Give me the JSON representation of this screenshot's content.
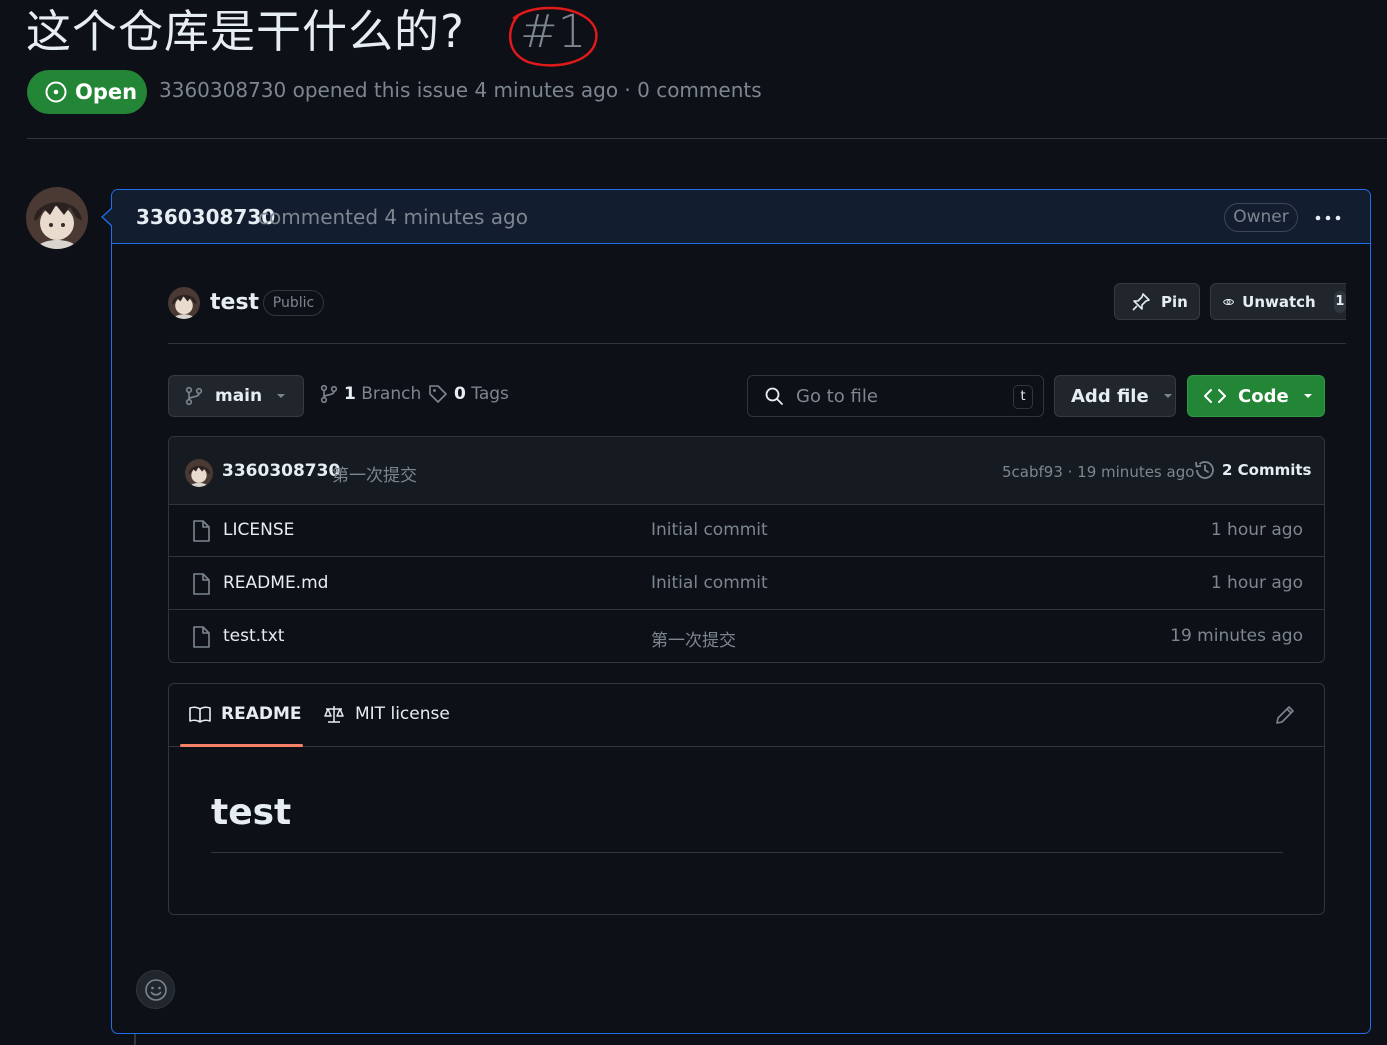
{
  "issue": {
    "title": "这个仓库是干什么的?",
    "number": "#1",
    "status": "Open",
    "author": "3360308730",
    "opened_text": "opened this issue 4 minutes ago · 0 comments"
  },
  "comment": {
    "author": "3360308730",
    "meta": "commented 4 minutes ago",
    "role_badge": "Owner"
  },
  "repo": {
    "name": "test",
    "visibility": "Public",
    "pin_label": "Pin",
    "unwatch_label": "Unwatch",
    "watch_count": "1"
  },
  "toolbar": {
    "branch": "main",
    "branch_count": "1",
    "branch_label": "Branch",
    "tag_count": "0",
    "tag_label": "Tags",
    "search_placeholder": "Go to file",
    "search_kbd": "t",
    "add_file_label": "Add file",
    "code_label": "Code"
  },
  "latest_commit": {
    "author": "3360308730",
    "message": "第一次提交",
    "hash_time": "5cabf93 · 19 minutes ago",
    "commits_label": "2 Commits"
  },
  "files": [
    {
      "name": "LICENSE",
      "commit": "Initial commit",
      "time": "1 hour ago"
    },
    {
      "name": "README.md",
      "commit": "Initial commit",
      "time": "1 hour ago"
    },
    {
      "name": "test.txt",
      "commit": "第一次提交",
      "time": "19 minutes ago"
    }
  ],
  "readme": {
    "tab_readme": "README",
    "tab_license": "MIT license",
    "heading": "test"
  },
  "colors": {
    "background": "#0d1117",
    "open_green": "#238636",
    "accent_blue": "#1f6feb",
    "tab_underline": "#f78166",
    "annotation_red": "#e0191b"
  },
  "icons": [
    "issue-opened-icon",
    "kebab-horizontal-icon",
    "pin-icon",
    "eye-icon",
    "git-branch-icon",
    "tag-icon",
    "search-icon",
    "triangle-down-icon",
    "code-icon",
    "history-icon",
    "file-icon",
    "book-icon",
    "law-icon",
    "pencil-icon",
    "smiley-icon"
  ]
}
